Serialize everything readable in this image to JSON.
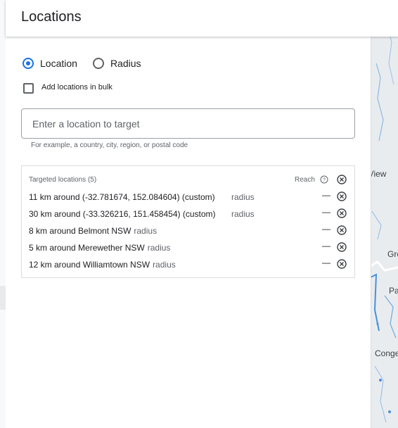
{
  "header": {
    "title": "Locations"
  },
  "mode": {
    "options": [
      {
        "label": "Location",
        "checked": true
      },
      {
        "label": "Radius",
        "checked": false
      }
    ]
  },
  "bulk": {
    "label": "Add locations in bulk",
    "checked": false
  },
  "search": {
    "placeholder": "Enter a location to target",
    "value": "",
    "hint": "For example, a country, city, region, or postal code"
  },
  "targets": {
    "header": "Targeted locations (5)",
    "reach_label": "Reach",
    "rows": [
      {
        "text": "11 km around (-32.781674, 152.084604) (custom)",
        "type": "radius",
        "reach": "—"
      },
      {
        "text": "30 km around (-33.326216, 151.458454) (custom)",
        "type": "radius",
        "reach": "—"
      },
      {
        "text": "8 km around Belmont NSW",
        "type": "radius",
        "reach": "—"
      },
      {
        "text": "5 km around Merewether NSW",
        "type": "radius",
        "reach": "—"
      },
      {
        "text": "12 km around Williamtown NSW",
        "type": "radius",
        "reach": "—"
      }
    ]
  },
  "map": {
    "labels": [
      "t View",
      "Gre",
      "Pa",
      "Conge"
    ],
    "colors": {
      "land": "#e9ecef",
      "water": "#4a90d9",
      "road": "#ffffff"
    }
  },
  "icons": {
    "remove": "remove-circle-icon",
    "help": "help-circle-icon"
  },
  "colors": {
    "accent": "#1a73e8",
    "text": "#202124",
    "muted": "#5f6368",
    "border": "#dadce0"
  }
}
